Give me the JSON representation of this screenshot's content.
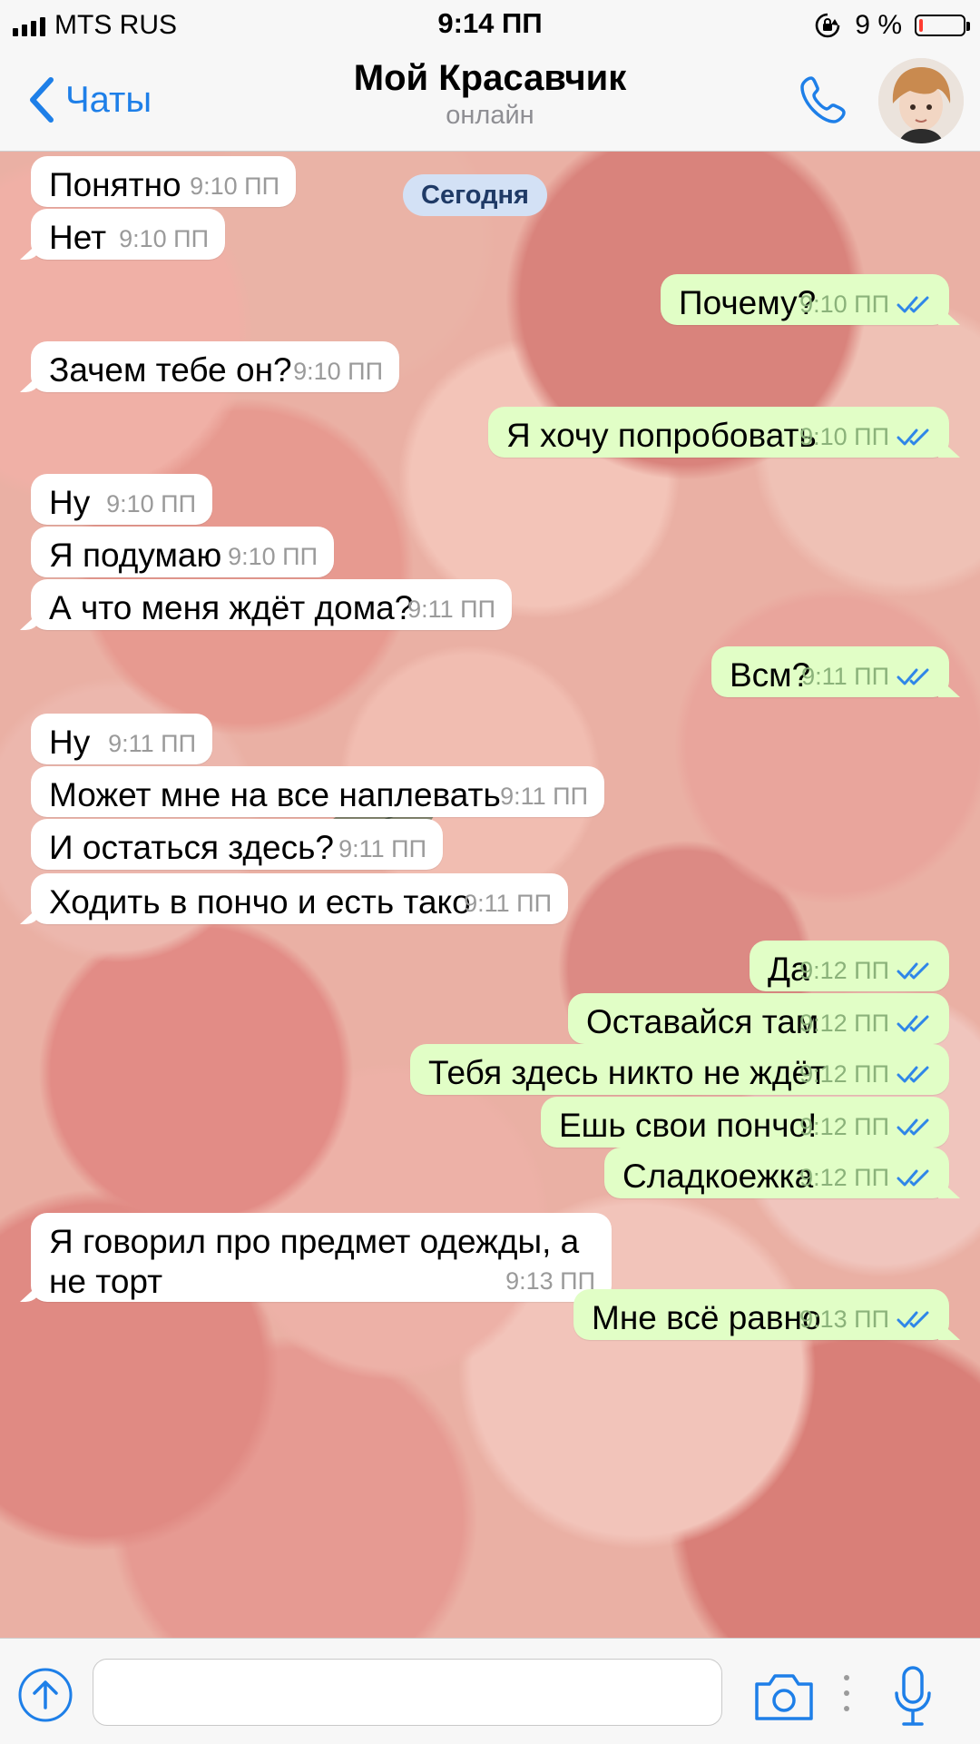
{
  "status_bar": {
    "carrier": "MTS RUS",
    "time": "9:14 ПП",
    "battery_percent": "9 %",
    "battery_level": 0.09
  },
  "header": {
    "back_label": "Чаты",
    "title": "Мой Красавчик",
    "status": "онлайн"
  },
  "chat": {
    "date_separator": "Сегодня",
    "messages": [
      {
        "dir": "in",
        "text": "Понятно",
        "time": "9:10 ПП"
      },
      {
        "dir": "in",
        "text": "Нет",
        "time": "9:10 ПП"
      },
      {
        "dir": "out",
        "text": "Почему?",
        "time": "9:10 ПП",
        "read": true
      },
      {
        "dir": "in",
        "text": "Зачем тебе он?",
        "time": "9:10 ПП"
      },
      {
        "dir": "out",
        "text": "Я хочу попробовать",
        "time": "9:10 ПП",
        "read": true
      },
      {
        "dir": "in",
        "text": "Ну",
        "time": "9:10 ПП"
      },
      {
        "dir": "in",
        "text": "Я подумаю",
        "time": "9:10 ПП"
      },
      {
        "dir": "in",
        "text": "А что меня ждёт дома?",
        "time": "9:11 ПП"
      },
      {
        "dir": "out",
        "text": "Всм?",
        "time": "9:11 ПП",
        "read": true
      },
      {
        "dir": "in",
        "text": "Ну",
        "time": "9:11 ПП"
      },
      {
        "dir": "in",
        "text": "Может мне на все наплевать",
        "time": "9:11 ПП"
      },
      {
        "dir": "in",
        "text": "И остаться здесь?",
        "time": "9:11 ПП"
      },
      {
        "dir": "in",
        "text": "Ходить в пончо и есть тако",
        "time": "9:11 ПП"
      },
      {
        "dir": "out",
        "text": "Да",
        "time": "9:12 ПП",
        "read": true
      },
      {
        "dir": "out",
        "text": "Оставайся там",
        "time": "9:12 ПП",
        "read": true
      },
      {
        "dir": "out",
        "text": "Тебя здесь никто не ждёт",
        "time": "9:12 ПП",
        "read": true
      },
      {
        "dir": "out",
        "text": "Ешь свои пончо!",
        "time": "9:12 ПП",
        "read": true
      },
      {
        "dir": "out",
        "text": "Сладкоежка",
        "time": "9:12 ПП",
        "read": true
      },
      {
        "dir": "in",
        "text": "Я говорил про предмет одежды, а\nне торт",
        "time": "9:13 ПП"
      },
      {
        "dir": "out",
        "text": "Мне всё равно",
        "time": "9:13 ПП",
        "read": true
      }
    ]
  },
  "input_bar": {
    "value": "",
    "placeholder": ""
  },
  "icons": {
    "back": "chevron-left-icon",
    "call": "phone-icon",
    "attach": "upload-arrow-icon",
    "camera": "camera-icon",
    "more": "vertical-dots-icon",
    "mic": "microphone-icon",
    "read_receipt": "double-check-icon"
  },
  "colors": {
    "accent": "#1e7fe8",
    "outgoing_bubble": "#e1fec6",
    "incoming_bubble": "#ffffff",
    "date_pill": "#d3e1f5",
    "battery_low": "#ff3b30"
  }
}
